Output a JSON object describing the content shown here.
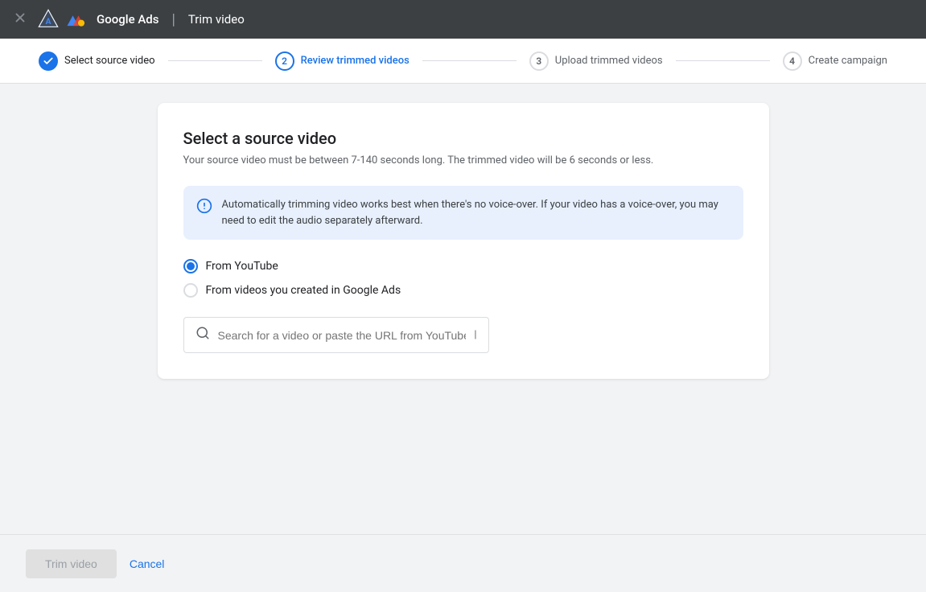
{
  "topbar": {
    "close_icon": "✕",
    "brand": "Google Ads",
    "divider": "|",
    "title": "Trim video"
  },
  "stepper": {
    "steps": [
      {
        "id": "step-1",
        "number": "✓",
        "label": "Select source video",
        "state": "done"
      },
      {
        "id": "step-2",
        "number": "2",
        "label": "Review trimmed videos",
        "state": "active"
      },
      {
        "id": "step-3",
        "number": "3",
        "label": "Upload trimmed videos",
        "state": "inactive"
      },
      {
        "id": "step-4",
        "number": "4",
        "label": "Create campaign",
        "state": "inactive"
      }
    ]
  },
  "card": {
    "title": "Select a source video",
    "subtitle": "Your source video must be between 7-140 seconds long. The trimmed video will be 6 seconds or less.",
    "info_text": "Automatically trimming video works best when there's no voice-over. If your video has a voice-over, you may need to edit the audio separately afterward.",
    "radio_options": [
      {
        "id": "youtube",
        "label": "From YouTube",
        "selected": true
      },
      {
        "id": "google-ads",
        "label": "From videos you created in Google Ads",
        "selected": false
      }
    ],
    "search_placeholder": "Search for a video or paste the URL from YouTube"
  },
  "footer": {
    "trim_button": "Trim video",
    "cancel_button": "Cancel"
  },
  "icons": {
    "info": "ℹ",
    "search": "🔍",
    "close": "✕"
  }
}
